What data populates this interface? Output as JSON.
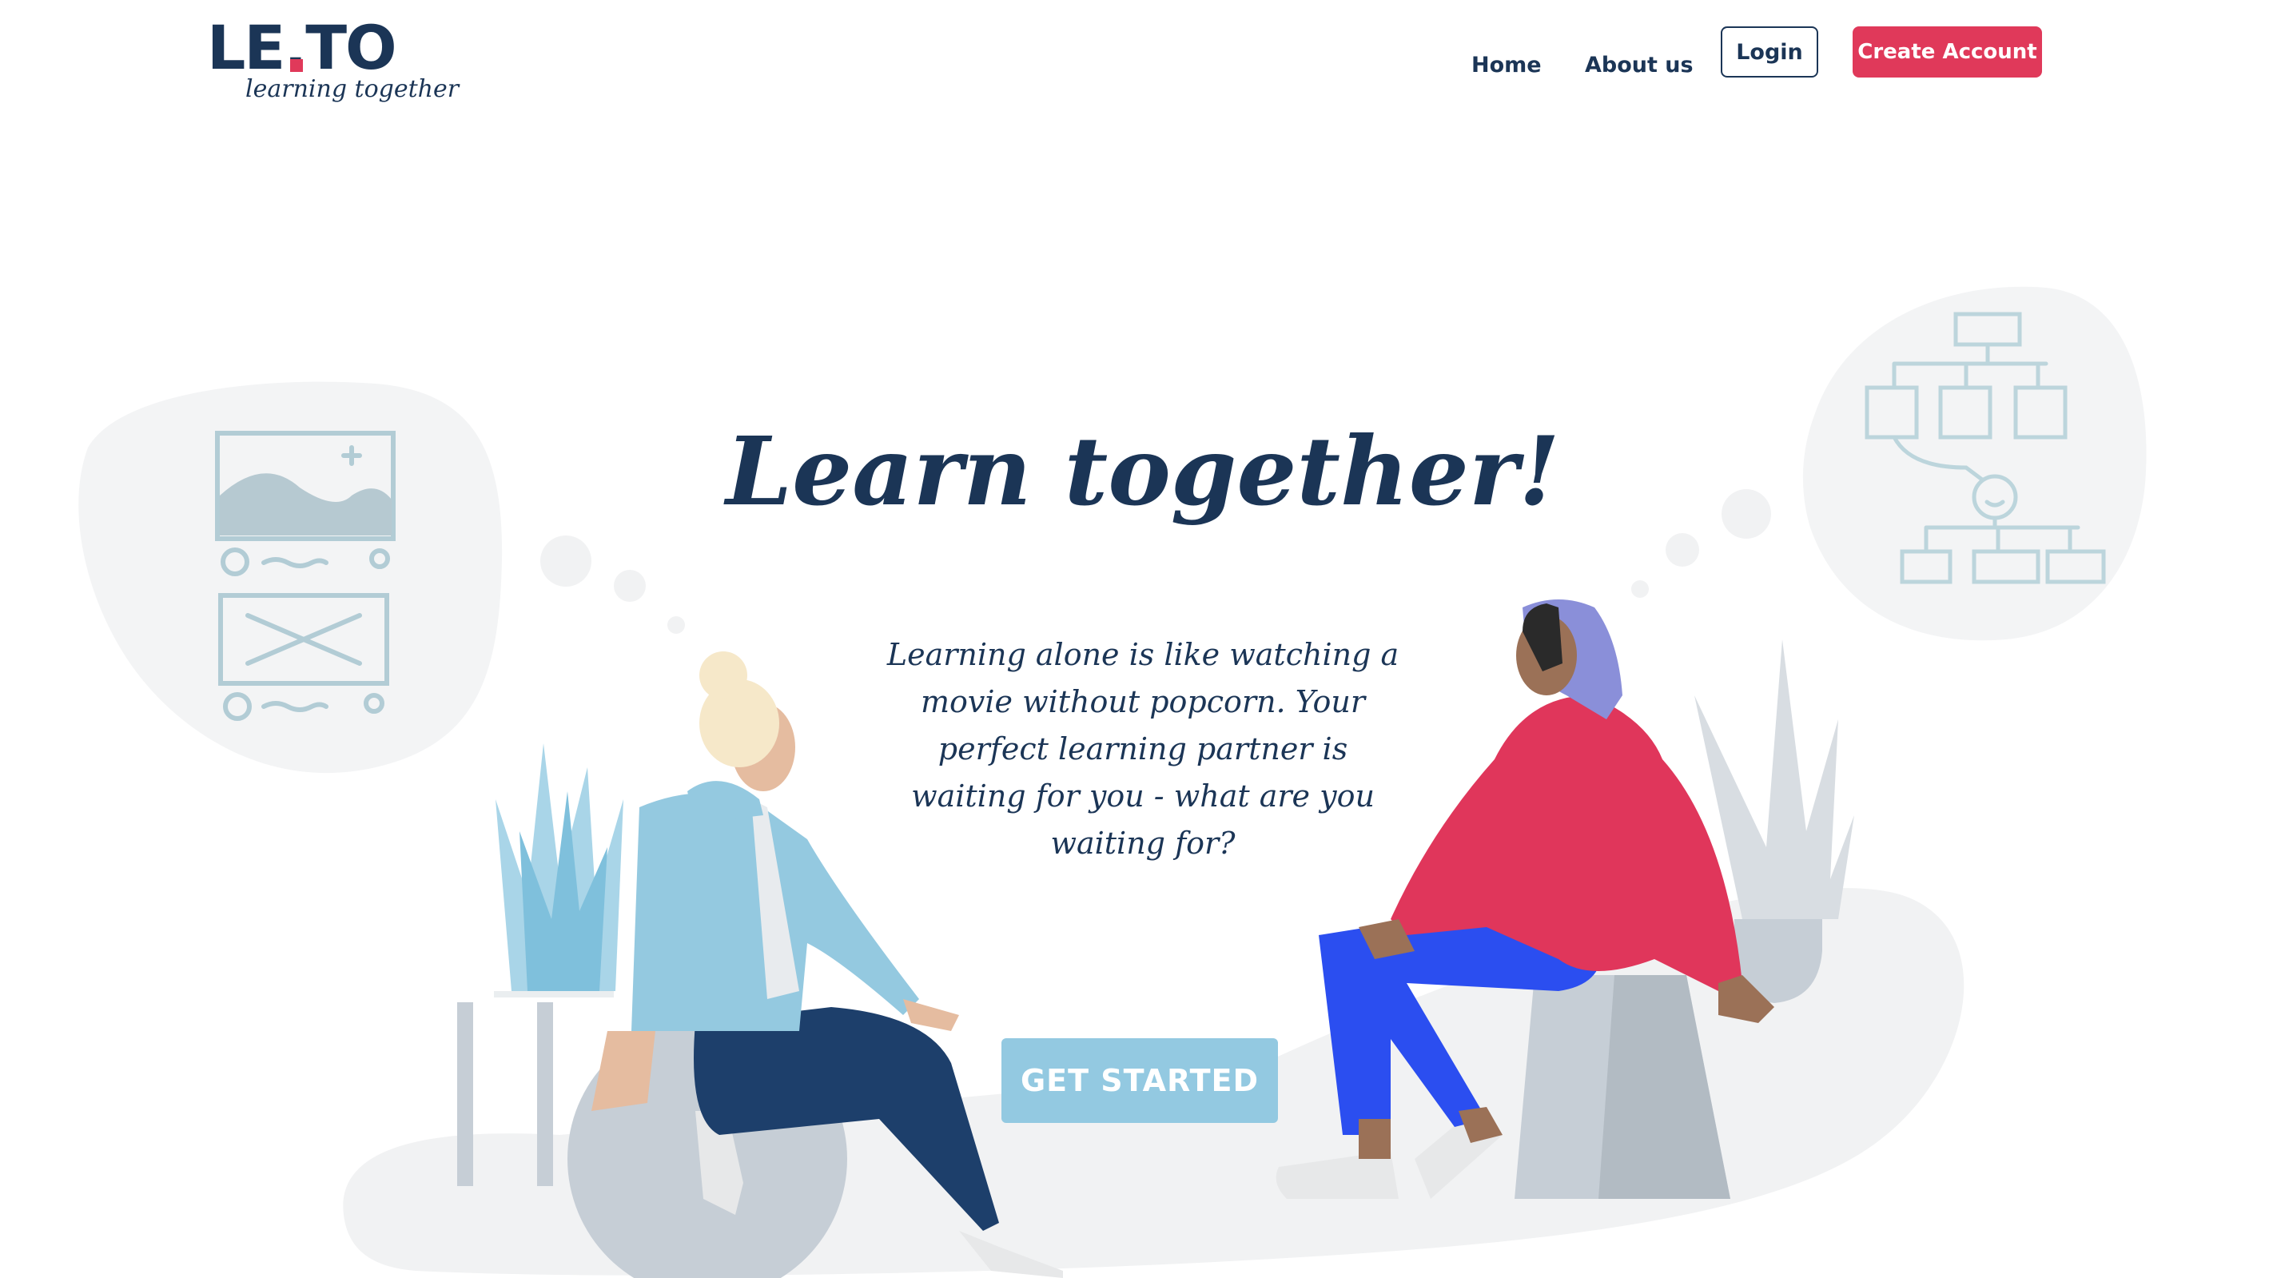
{
  "header": {
    "logo_text": "LE.TO",
    "logo_tagline": "learning together",
    "nav": [
      {
        "label": "Home"
      },
      {
        "label": "About us"
      }
    ],
    "login_label": "Login",
    "create_account_label": "Create Account"
  },
  "hero": {
    "title": "Learn together!",
    "subtitle": "Learning alone is like watching a movie without popcorn. Your perfect learning partner is waiting for you - what are you waiting for?",
    "cta_label": "GET STARTED"
  },
  "colors": {
    "navy": "#1b3556",
    "accent": "#e0395a",
    "cta": "#93c9e1",
    "blob": "#f3f4f5"
  }
}
